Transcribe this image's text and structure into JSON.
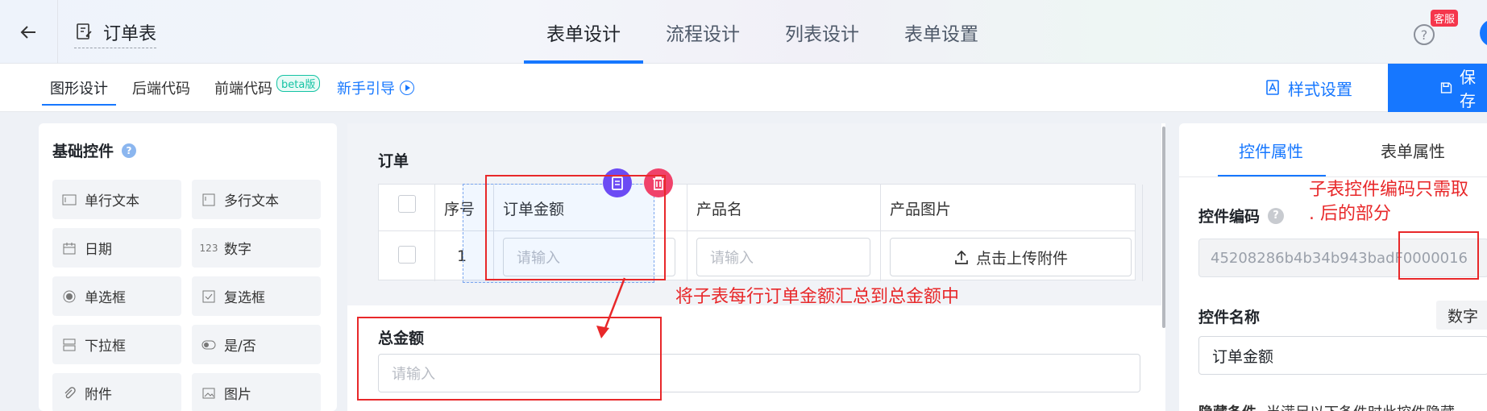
{
  "header": {
    "back_label": "←",
    "form_title": "订单表",
    "tabs": [
      "表单设计",
      "流程设计",
      "列表设计",
      "表单设置"
    ],
    "active_tab": "表单设计",
    "help_label": "?",
    "service_badge": "客服"
  },
  "subnav": {
    "tabs": [
      "图形设计",
      "后端代码",
      "前端代码"
    ],
    "beta_badge": "beta版",
    "guide_link": "新手引导",
    "style_button": "样式设置",
    "save_button": "保存"
  },
  "left_panel": {
    "title": "基础控件",
    "help_label": "?",
    "controls": [
      {
        "label": "单行文本",
        "icon": "single-line-text-icon"
      },
      {
        "label": "多行文本",
        "icon": "multi-line-text-icon"
      },
      {
        "label": "日期",
        "icon": "calendar-icon"
      },
      {
        "label": "数字",
        "icon": "number-icon"
      },
      {
        "label": "单选框",
        "icon": "radio-icon"
      },
      {
        "label": "复选框",
        "icon": "checkbox-icon"
      },
      {
        "label": "下拉框",
        "icon": "dropdown-icon"
      },
      {
        "label": "是/否",
        "icon": "toggle-icon"
      },
      {
        "label": "附件",
        "icon": "paperclip-icon"
      },
      {
        "label": "图片",
        "icon": "image-icon"
      }
    ],
    "number_icon_text": "123"
  },
  "canvas": {
    "subform_title": "订单",
    "columns": [
      "序号",
      "订单金额",
      "产品名",
      "产品图片"
    ],
    "row_number": "1",
    "input_placeholder": "请输入",
    "upload_label": "点击上传附件",
    "total_label": "总金额",
    "total_placeholder": "请输入"
  },
  "right_panel": {
    "tabs": [
      "控件属性",
      "表单属性"
    ],
    "active_tab": "控件属性",
    "code_label": "控件编码",
    "help_label": "?",
    "code_value": "45208286b4b34b943badF0000016",
    "name_label": "控件名称",
    "type_tag": "数字",
    "name_value": "订单金额",
    "hidden_label": "隐藏条件",
    "hidden_desc": "当满足以下条件时此控件隐藏"
  },
  "annotations": {
    "subtable_note": "子表控件编码只需取 . 后的部分",
    "sum_note": "将子表每行订单金额汇总到总金额中"
  },
  "colors": {
    "primary": "#1677ff",
    "annotation": "#e8282a",
    "copy_fab": "#6c4bf4",
    "delete_fab": "#f0426a"
  }
}
